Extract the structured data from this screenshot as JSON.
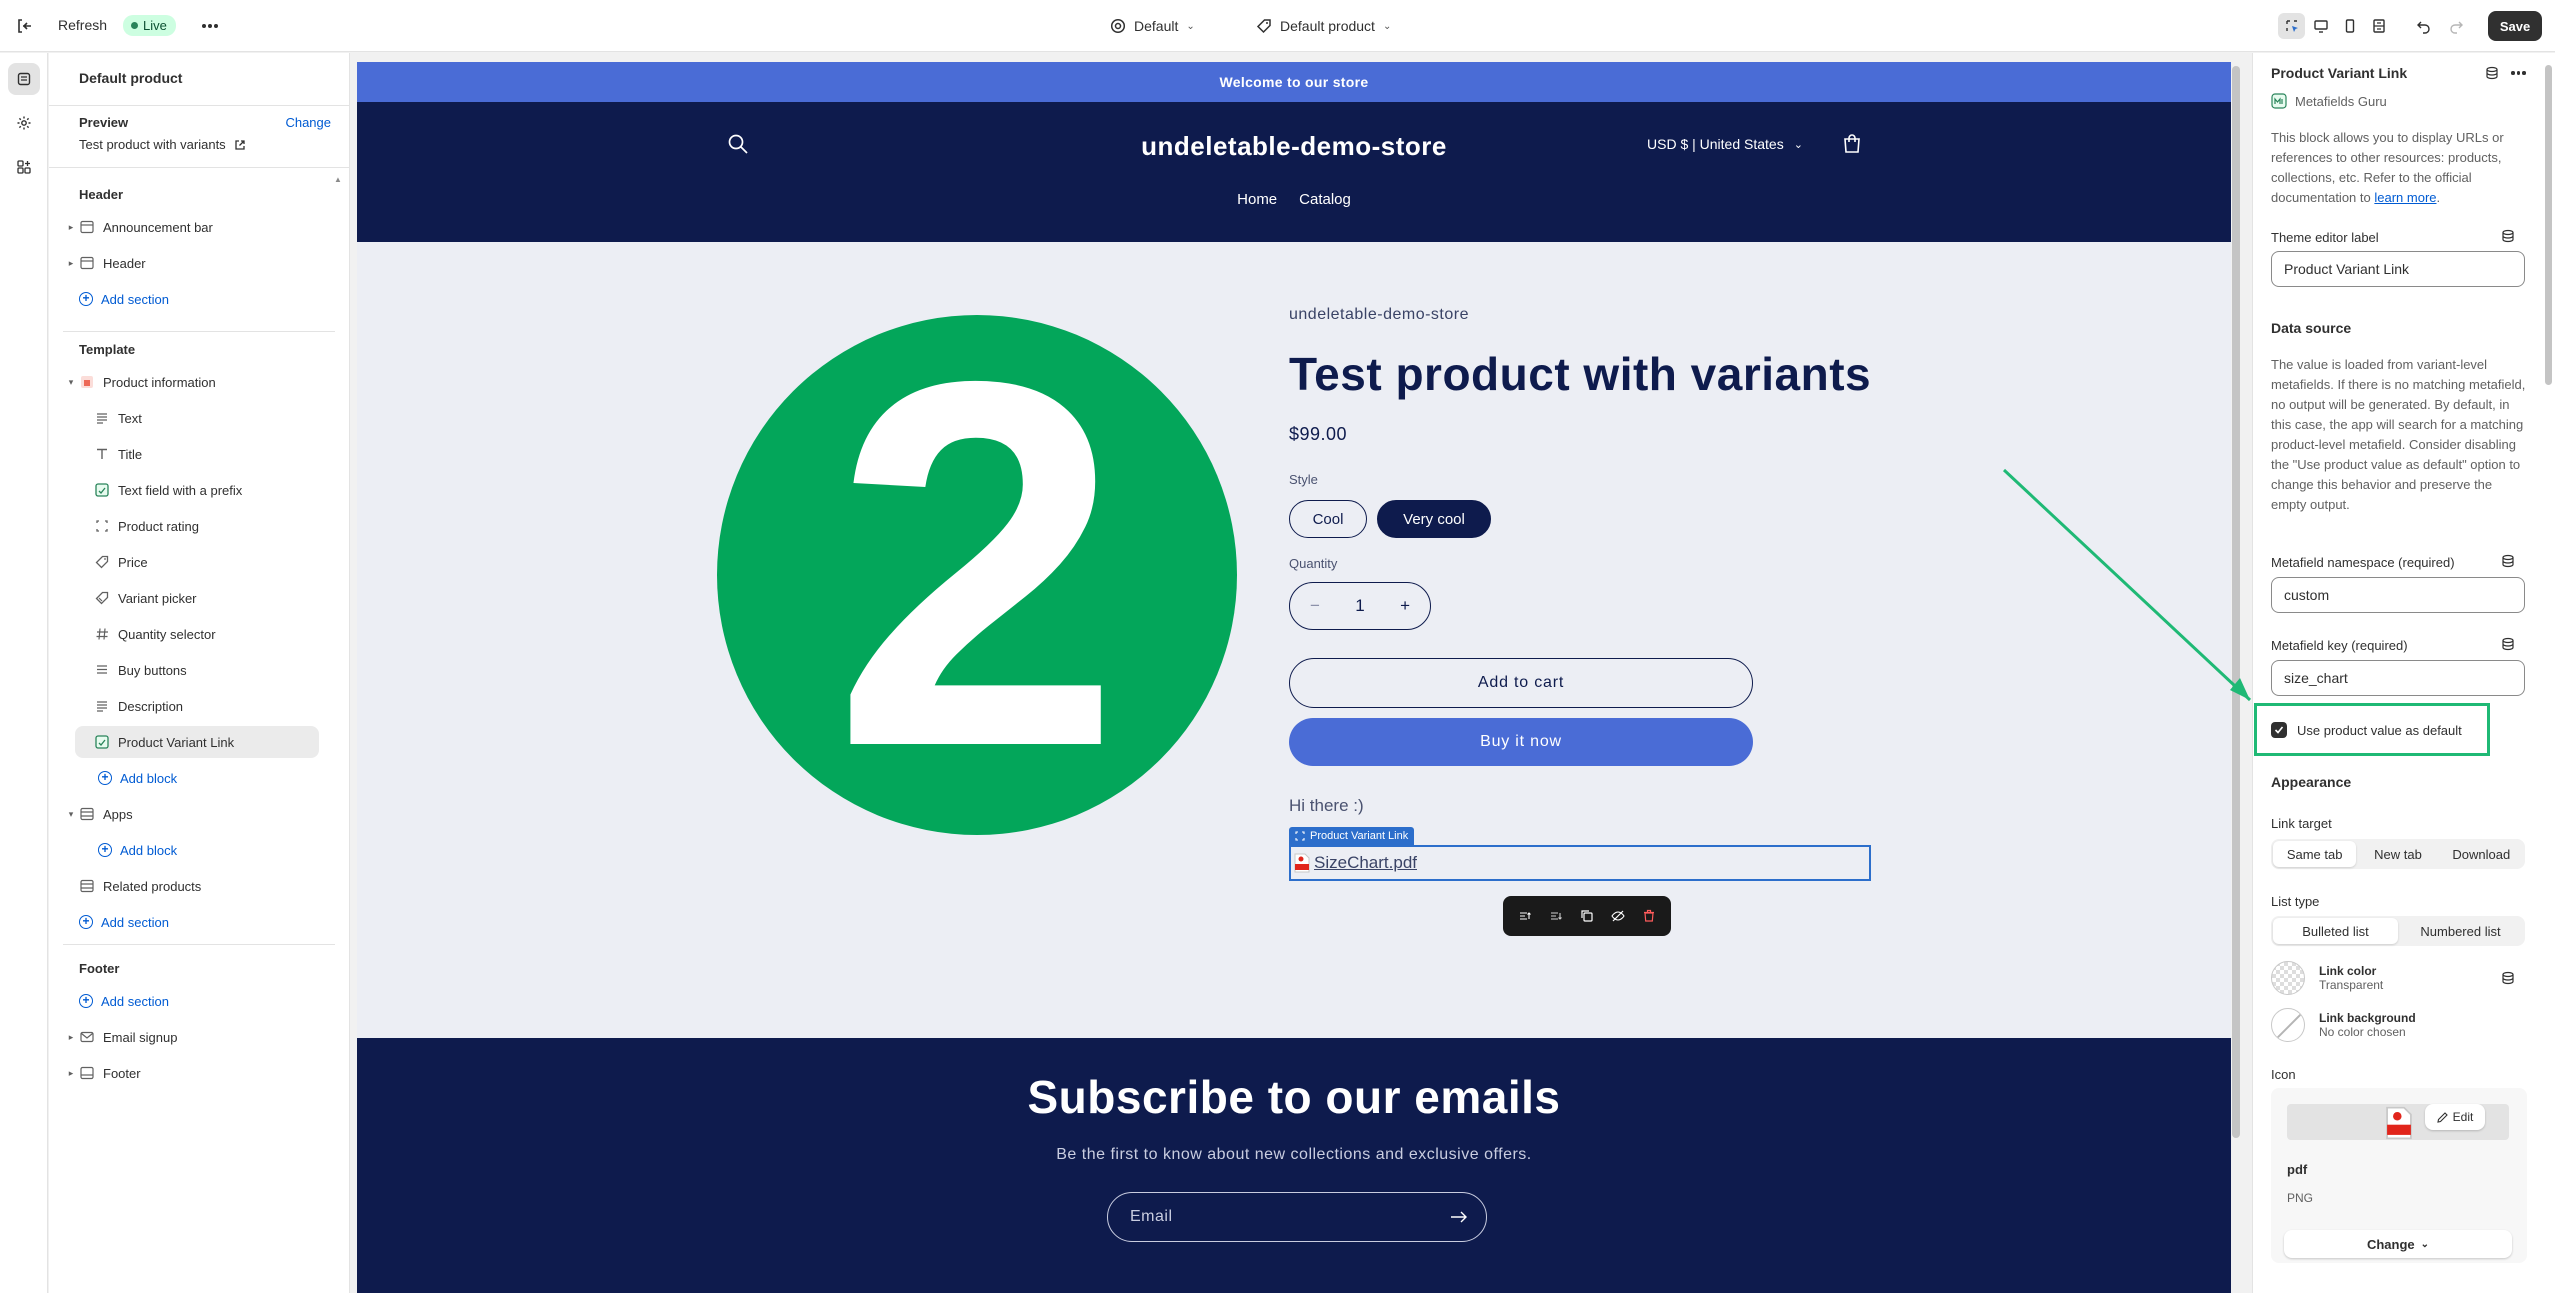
{
  "topbar": {
    "refresh_label": "Refresh",
    "live_badge": "Live",
    "theme_select": "Default",
    "template_select": "Default product",
    "save_label": "Save"
  },
  "left": {
    "page_title": "Default product",
    "preview_label": "Preview",
    "preview_change": "Change",
    "preview_value": "Test product with variants",
    "header_group": "Header",
    "header_items": [
      "Announcement bar",
      "Header"
    ],
    "add_section": "Add section",
    "template_group": "Template",
    "product_information": "Product information",
    "blocks": [
      "Text",
      "Title",
      "Text field with a prefix",
      "Product rating",
      "Price",
      "Variant picker",
      "Quantity selector",
      "Buy buttons",
      "Description",
      "Product Variant Link"
    ],
    "add_block": "Add block",
    "apps": "Apps",
    "related_products": "Related products",
    "footer_group": "Footer",
    "footer_items": [
      "Email signup",
      "Footer"
    ]
  },
  "store": {
    "announcement": "Welcome to our store",
    "logo": "undeletable-demo-store",
    "currency": "USD $ | United States",
    "nav": [
      "Home",
      "Catalog"
    ],
    "image_digit": "2",
    "vendor": "undeletable-demo-store",
    "product_title": "Test product with variants",
    "price": "$99.00",
    "style_label": "Style",
    "style_options": [
      "Cool",
      "Very cool"
    ],
    "selected_style": "Very cool",
    "quantity_label": "Quantity",
    "quantity_value": "1",
    "add_to_cart": "Add to cart",
    "buy_now": "Buy it now",
    "custom_text": "Hi there :)",
    "block_tag": "Product Variant Link",
    "link_text": "SizeChart.pdf",
    "newsletter_title": "Subscribe to our emails",
    "newsletter_sub": "Be the first to know about new collections and exclusive offers.",
    "email_placeholder": "Email"
  },
  "right": {
    "title": "Product Variant Link",
    "app_name": "Metafields Guru",
    "description": "This block allows you to display URLs or references to other resources: products, collections, etc. Refer to the official documentation to",
    "learn_more": "learn more",
    "theme_label_title": "Theme editor label",
    "theme_label_value": "Product Variant Link",
    "data_source": "Data source",
    "data_source_text": "The value is loaded from variant-level metafields. If there is no matching metafield, no output will be generated. By default, in this case, the app will search for a matching product-level metafield. Consider disabling the \"Use product value as default\" option to change this behavior and preserve the empty output.",
    "namespace_label": "Metafield namespace (required)",
    "namespace_value": "custom",
    "key_label": "Metafield key (required)",
    "key_value": "size_chart",
    "use_default_label": "Use product value as default",
    "use_default_checked": true,
    "appearance": "Appearance",
    "link_target_label": "Link target",
    "link_target_options": [
      "Same tab",
      "New tab",
      "Download"
    ],
    "link_target_selected": "Same tab",
    "list_type_label": "List type",
    "list_type_options": [
      "Bulleted list",
      "Numbered list"
    ],
    "list_type_selected": "Bulleted list",
    "link_color_label": "Link color",
    "link_color_value": "Transparent",
    "link_bg_label": "Link background",
    "link_bg_value": "No color chosen",
    "icon_label": "Icon",
    "icon_edit": "Edit",
    "icon_name": "pdf",
    "icon_type": "PNG",
    "icon_change": "Change"
  },
  "colors": {
    "store_announcement": "#4a6cd6",
    "store_navy": "#0e1b4d",
    "product_green": "#03a65a",
    "highlight_green": "#1fb975",
    "selection_blue": "#2c6ecb"
  }
}
